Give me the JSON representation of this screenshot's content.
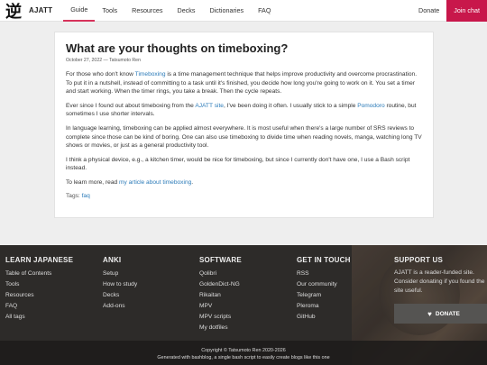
{
  "nav": {
    "logo_glyph": "逆",
    "logo_text": "AJATT",
    "links": [
      "Guide",
      "Tools",
      "Resources",
      "Decks",
      "Dictionaries",
      "FAQ"
    ],
    "active": "Guide",
    "donate": "Donate",
    "join_chat": "Join chat"
  },
  "article": {
    "title": "What are your thoughts on timeboxing?",
    "meta": "October 27, 2022 — Tatsumoto Ren",
    "p1_a": "For those who don't know ",
    "p1_link": "Timeboxing",
    "p1_b": " is a time management technique that helps improve productivity and overcome procrastination. To put it in a nutshell, instead of committing to a task until it's finished, you decide how long you're going to work on it. You set a timer and start working. When the timer rings, you take a break. Then the cycle repeats.",
    "p2_a": "Ever since I found out about timeboxing from the ",
    "p2_link1": "AJATT site",
    "p2_b": ", I've been doing it often. I usually stick to a simple ",
    "p2_link2": "Pomodoro",
    "p2_c": " routine, but sometimes I use shorter intervals.",
    "p3": "In language learning, timeboxing can be applied almost everywhere. It is most useful when there's a large number of SRS reviews to complete since those can be kind of boring. One can also use timeboxing to divide time when reading novels, manga, watching long TV shows or movies, or just as a general productivity tool.",
    "p4": "I think a physical device, e.g., a kitchen timer, would be nice for timeboxing, but since I currently don't have one, I use a Bash script instead.",
    "p5_a": "To learn more, read ",
    "p5_link": "my article about timeboxing",
    "p5_b": ".",
    "tags_label": "Tags: ",
    "tag": "faq"
  },
  "footer": {
    "learn": {
      "heading": "LEARN JAPANESE",
      "items": [
        "Table of Contents",
        "Tools",
        "Resources",
        "FAQ",
        "All tags"
      ]
    },
    "anki": {
      "heading": "ANKI",
      "items": [
        "Setup",
        "How to study",
        "Decks",
        "Add-ons"
      ]
    },
    "software": {
      "heading": "SOFTWARE",
      "items": [
        "Qolibri",
        "GoldenDict-NG",
        "Rikaitan",
        "MPV",
        "MPV scripts",
        "My dotfiles"
      ]
    },
    "touch": {
      "heading": "GET IN TOUCH",
      "items": [
        "RSS",
        "Our community",
        "Telegram",
        "Pleroma",
        "GitHub"
      ]
    },
    "support": {
      "heading": "SUPPORT US",
      "text": "AJATT is a reader-funded site. Consider donating if you found the site useful.",
      "button": "DONATE"
    },
    "copyright": "Copyright © Tatsumoto Ren 2020-2026",
    "generated": "Generated with bashblog, a single bash script to easily create blogs like this one"
  }
}
